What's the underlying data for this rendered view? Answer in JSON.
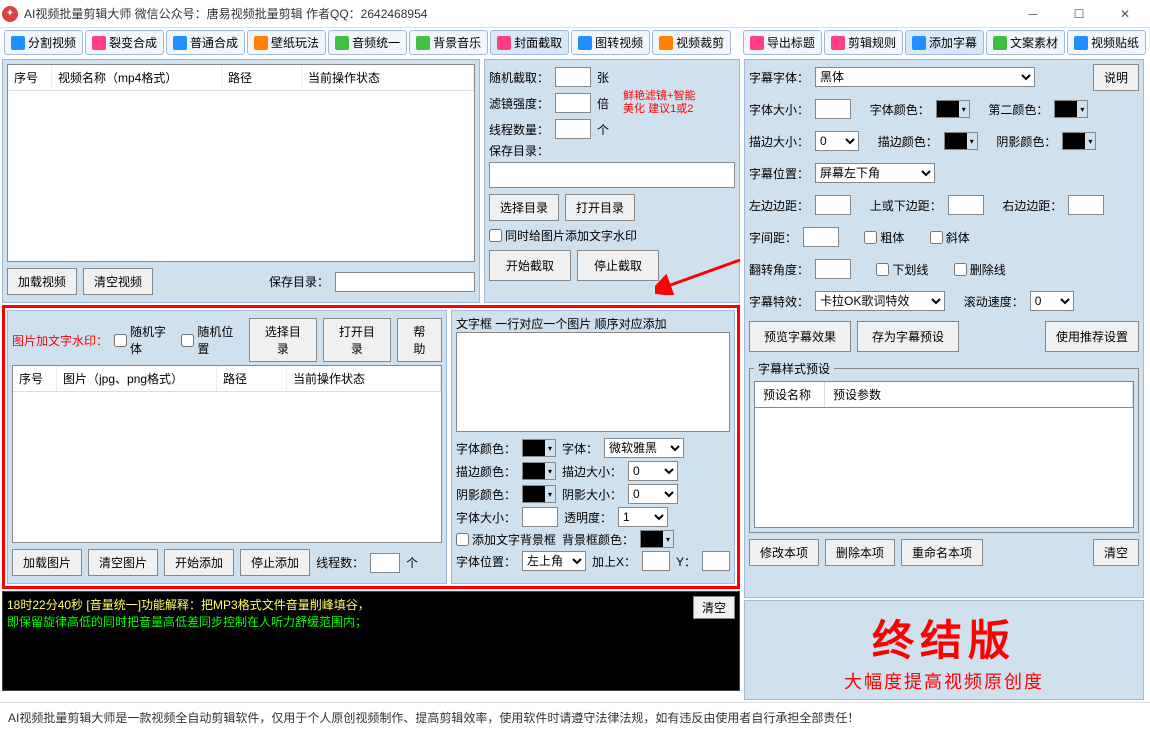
{
  "titlebar": {
    "title": "AI视频批量剪辑大师   微信公众号：唐易视频批量剪辑    作者QQ：2642468954"
  },
  "tabs_left": [
    {
      "label": "分割视频",
      "color": "#1e90ff"
    },
    {
      "label": "裂变合成",
      "color": "#ff4080"
    },
    {
      "label": "普通合成",
      "color": "#1e90ff"
    },
    {
      "label": "壁纸玩法",
      "color": "#ff8000"
    },
    {
      "label": "音频统一",
      "color": "#40c040"
    },
    {
      "label": "背景音乐",
      "color": "#40c040"
    },
    {
      "label": "封面截取",
      "color": "#ff4080"
    },
    {
      "label": "图转视频",
      "color": "#1e90ff"
    },
    {
      "label": "视频裁剪",
      "color": "#ff8000"
    }
  ],
  "tabs_right": [
    {
      "label": "导出标题",
      "color": "#ff4080"
    },
    {
      "label": "剪辑规则",
      "color": "#ff4080"
    },
    {
      "label": "添加字幕",
      "color": "#1e90ff"
    },
    {
      "label": "文案素材",
      "color": "#40c040"
    },
    {
      "label": "视频贴纸",
      "color": "#1e90ff"
    }
  ],
  "video_list": {
    "cols": [
      "序号",
      "视频名称（mp4格式）",
      "路径",
      "当前操作状态"
    ],
    "load_btn": "加载视频",
    "clear_btn": "清空视频",
    "save_dir_lbl": "保存目录："
  },
  "cover": {
    "rand_cut_lbl": "随机截取：",
    "rand_cut_unit": "张",
    "filter_lbl": "滤镜强度：",
    "filter_unit": "倍",
    "hint1": "鲜艳滤镜+智能",
    "hint2": "美化 建议1或2",
    "threads_lbl": "线程数量：",
    "threads_unit": "个",
    "save_dir_lbl": "保存目录：",
    "choose_dir": "选择目录",
    "open_dir": "打开目录",
    "watermark_chk": "同时给图片添加文字水印",
    "start_btn": "开始截取",
    "stop_btn": "停止截取"
  },
  "watermark": {
    "title": "图片加文字水印：",
    "rand_font": "随机字体",
    "rand_pos": "随机位置",
    "choose_dir": "选择目录",
    "open_dir": "打开目录",
    "help": "帮助",
    "cols": [
      "序号",
      "图片（jpg、png格式）",
      "路径",
      "当前操作状态"
    ],
    "load_btn": "加载图片",
    "clear_btn": "清空图片",
    "start_btn": "开始添加",
    "stop_btn": "停止添加",
    "threads_lbl": "线程数：",
    "threads_unit": "个"
  },
  "textbox": {
    "title": "文字框 一行对应一个图片 顺序对应添加",
    "font_color": "字体颜色：",
    "font_lbl": "字体：",
    "font_val": "微软雅黑",
    "stroke_color": "描边颜色：",
    "stroke_size": "描边大小：",
    "stroke_val": "0",
    "shadow_color": "阴影颜色：",
    "shadow_size": "阴影大小：",
    "shadow_val": "0",
    "font_size": "字体大小：",
    "opacity": "透明度：",
    "opacity_val": "1",
    "bg_chk": "添加文字背景框",
    "bg_color": "背景框颜色：",
    "pos_lbl": "字体位置：",
    "pos_val": "左上角",
    "add_x": "加上X：",
    "y_lbl": "Y："
  },
  "subtitle": {
    "explain_btn": "说明",
    "font_lbl": "字幕字体：",
    "font_val": "黑体",
    "size_lbl": "字体大小：",
    "color_lbl": "字体颜色：",
    "color2_lbl": "第二颜色：",
    "stroke_lbl": "描边大小：",
    "stroke_val": "0",
    "stroke_color": "描边颜色：",
    "shadow_color": "阴影颜色：",
    "pos_lbl": "字幕位置：",
    "pos_val": "屏幕左下角",
    "left_lbl": "左边边距：",
    "tb_lbl": "上或下边距：",
    "right_lbl": "右边边距：",
    "spacing_lbl": "字间距：",
    "bold": "粗体",
    "italic": "斜体",
    "rotate_lbl": "翻转角度：",
    "underline": "下划线",
    "strike": "删除线",
    "effect_lbl": "字幕特效：",
    "effect_val": "卡拉OK歌词特效",
    "speed_lbl": "滚动速度：",
    "speed_val": "0",
    "preview_btn": "预览字幕效果",
    "save_btn": "存为字幕预设",
    "recommend_btn": "使用推荐设置",
    "preset_title": "字幕样式预设",
    "preset_cols": [
      "预设名称",
      "预设参数"
    ],
    "edit_btn": "修改本项",
    "del_btn": "删除本项",
    "rename_btn": "重命名本项",
    "clear_btn": "清空"
  },
  "log": {
    "line1": "18时22分40秒 [音量统一]功能解释：把MP3格式文件音量削峰填谷，",
    "line2": "        即保留旋律高低的同时把音量高低差同步控制在人听力舒缓范围内；",
    "clear": "清空"
  },
  "brand": {
    "big": "终结版",
    "sub": "大幅度提高视频原创度"
  },
  "footer": "AI视频批量剪辑大师是一款视频全自动剪辑软件，仅用于个人原创视频制作、提高剪辑效率，使用软件时请遵守法律法规，如有违反由使用者自行承担全部责任！"
}
